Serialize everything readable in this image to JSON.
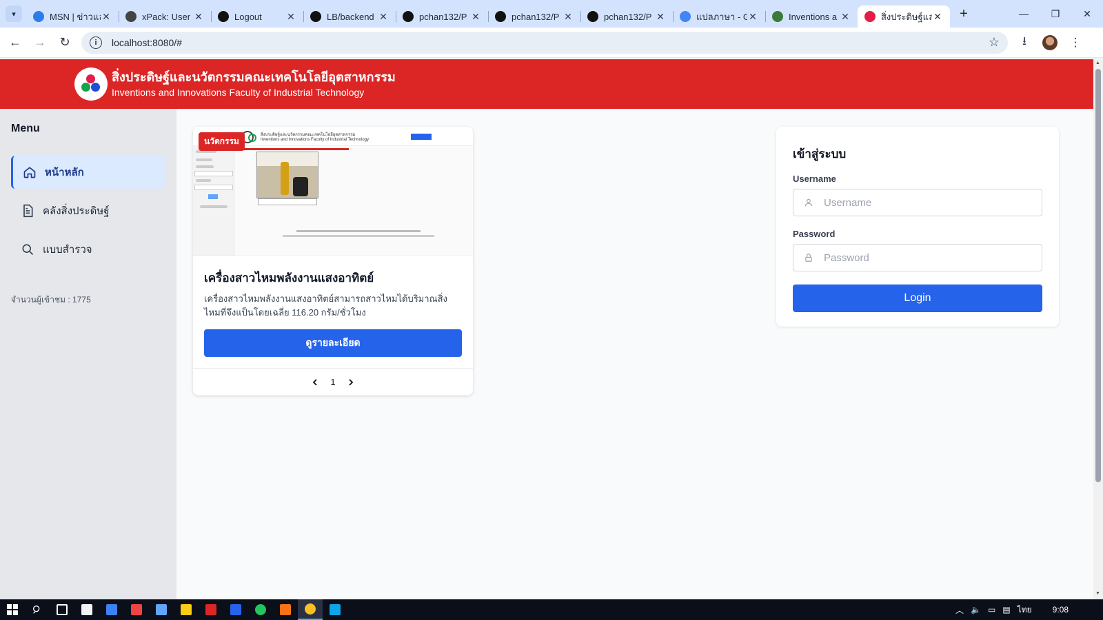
{
  "browser": {
    "tabs": [
      {
        "title": "MSN | ข่าวและ",
        "color": "#2b7de9",
        "active": false
      },
      {
        "title": "xPack: User",
        "color": "#444444",
        "active": false
      },
      {
        "title": "Logout",
        "color": "#111111",
        "active": false
      },
      {
        "title": "LB/backend",
        "color": "#111111",
        "active": false
      },
      {
        "title": "pchan132/P",
        "color": "#111111",
        "active": false
      },
      {
        "title": "pchan132/P",
        "color": "#111111",
        "active": false
      },
      {
        "title": "pchan132/P",
        "color": "#111111",
        "active": false
      },
      {
        "title": "แปลภาษา - G",
        "color": "#4285f4",
        "active": false
      },
      {
        "title": "Inventions a",
        "color": "#3b7a3b",
        "active": false
      },
      {
        "title": "สิ่งประดิษฐ์และ",
        "color": "#e11d48",
        "active": true
      }
    ],
    "url": "localhost:8080/#"
  },
  "header": {
    "title_th": "สิ่งประดิษฐ์และนวัตกรรมคณะเทคโนโลยีอุตสาหกรรม",
    "title_en": "Inventions and Innovations Faculty of Industrial Technology"
  },
  "sidebar": {
    "menu_title": "Menu",
    "items": [
      {
        "label": "หน้าหลัก",
        "icon": "home-icon",
        "active": true
      },
      {
        "label": "คลังสิ่งประดิษฐ์",
        "icon": "document-icon",
        "active": false
      },
      {
        "label": "แบบสำรวจ",
        "icon": "search-icon",
        "active": false
      }
    ],
    "visitors": "จำนวนผู้เข้าชม : 1775"
  },
  "card": {
    "badge": "นวัตกรรม",
    "title": "เครื่องสาวไหมพลังงานแสงอาทิตย์",
    "description": "เครื่องสาวไหมพลังงานแสงอาทิตย์สามารถสาวไหมได้บริมาณสิ่งไหมที่จึงแป็นโดยเฉลี่ย 116.20 กรัม/ชั่วโมง",
    "button": "ดูรายละเอียด",
    "page": "1",
    "thumb": {
      "head_th": "สิ่งประดิษฐ์และนวัตกรรมคณะเทคโนโลยีอุตสาหกรรม",
      "head_en": "Inventions and Innovations Faculty of Industrial Technology"
    }
  },
  "login": {
    "title": "เข้าสู่ระบบ",
    "username_label": "Username",
    "username_placeholder": "Username",
    "password_label": "Password",
    "password_placeholder": "Password",
    "button": "Login"
  },
  "taskbar": {
    "lang": "ไทย",
    "time": "9:08"
  },
  "colors": {
    "header": "#dc2626",
    "primary": "#2563eb",
    "active_menu_bg": "#dbeafe"
  }
}
